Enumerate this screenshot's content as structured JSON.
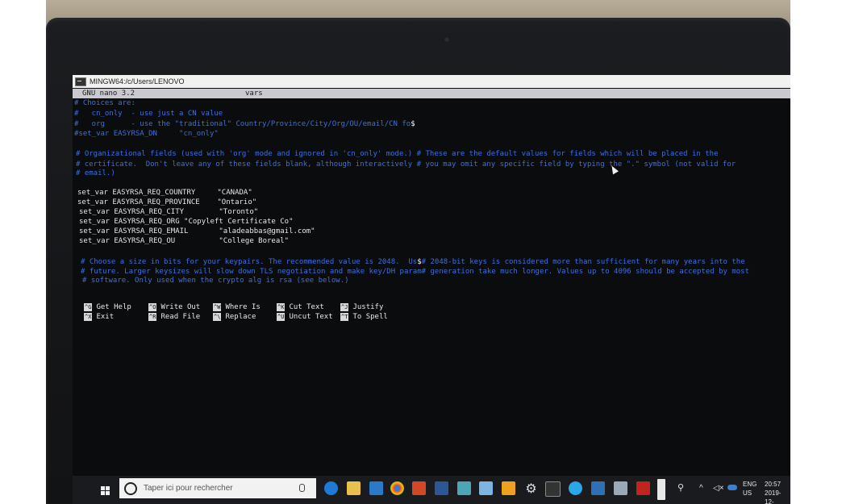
{
  "window": {
    "title": "MINGW64:/c/Users/LENOVO"
  },
  "nano": {
    "version": "GNU nano 3.2",
    "filename": "vars"
  },
  "lines": [
    {
      "text": "# Choices are:",
      "kind": "comment"
    },
    {
      "text": "#   cn_only  - use just a CN value",
      "kind": "comment"
    },
    {
      "text": "#   org      - use the \"traditional\" Country/Province/City/Org/OU/email/CN fo",
      "kind": "comment",
      "suffix": "$"
    },
    {
      "text": "#set_var EASYRSA_DN     \"cn_only\"",
      "kind": "comment"
    },
    {
      "text": "",
      "kind": "comment"
    },
    {
      "text": "# Organizational fields (used with 'org' mode and ignored in 'cn_only' mode.) # These are the default values for fields which will be placed in the",
      "kind": "comment"
    },
    {
      "text": "# certificate.  Don't leave any of these fields blank, although interactively # you may omit any specific field by typing the \".\" symbol (not valid for",
      "kind": "comment"
    },
    {
      "text": "# email.)",
      "kind": "comment"
    },
    {
      "text": "",
      "kind": "comment"
    },
    {
      "text": "set_var EASYRSA_REQ_COUNTRY     \"CANADA\"",
      "kind": "code"
    },
    {
      "text": "set_var EASYRSA_REQ_PROVINCE    \"Ontario\"",
      "kind": "code"
    },
    {
      "text": "set_var EASYRSA_REQ_CITY        \"Toronto\"",
      "kind": "code"
    },
    {
      "text": "set_var EASYRSA_REQ_ORG \"Copyleft Certificate Co\"",
      "kind": "code"
    },
    {
      "text": "set_var EASYRSA_REQ_EMAIL       \"aladeabbas@gmail.com\"",
      "kind": "code"
    },
    {
      "text": "set_var EASYRSA_REQ_OU          \"College Boreal\"",
      "kind": "code"
    },
    {
      "text": "",
      "kind": "comment"
    },
    {
      "text": "# Choose a size in bits for your keypairs. The recommended value is 2048.  Us",
      "kind": "comment",
      "suffix": "$",
      "tail": "# 2048-bit keys is considered more than sufficient for many years into the"
    },
    {
      "text": "# future. Larger keysizes will slow down TLS negotiation and make key/DH param# generation take much longer. Values up to 4096 should be accepted by most",
      "kind": "comment"
    },
    {
      "text": "# software. Only used when the crypto alg is rsa (see below.)",
      "kind": "comment"
    }
  ],
  "shortcuts": [
    {
      "key": "^G",
      "label": "Get Help"
    },
    {
      "key": "^O",
      "label": "Write Out"
    },
    {
      "key": "^W",
      "label": "Where Is"
    },
    {
      "key": "^K",
      "label": "Cut Text"
    },
    {
      "key": "^J",
      "label": "Justify"
    },
    {
      "key": "^X",
      "label": "Exit"
    },
    {
      "key": "^R",
      "label": "Read File"
    },
    {
      "key": "^\\",
      "label": "Replace"
    },
    {
      "key": "^U",
      "label": "Uncut Text"
    },
    {
      "key": "^T",
      "label": "To Spell"
    }
  ],
  "taskbar": {
    "search_placeholder": "Taper ici pour rechercher",
    "language": "ENG",
    "region": "US",
    "time": "20:57",
    "date": "2019-12-",
    "icons": [
      "edge-icon",
      "file-explorer-icon",
      "store-icon",
      "chrome-icon",
      "powerpoint-icon",
      "word-icon",
      "app-icon",
      "app-icon",
      "app-icon",
      "settings-icon",
      "terminal-icon",
      "app-icon",
      "app-icon",
      "app-icon",
      "acrobat-icon"
    ]
  },
  "colors": {
    "comment": "#3b6fe0",
    "code": "#e6e6e6",
    "nano_header_bg": "#c9c9cf",
    "taskbar_bg": "#1a1b1f"
  }
}
